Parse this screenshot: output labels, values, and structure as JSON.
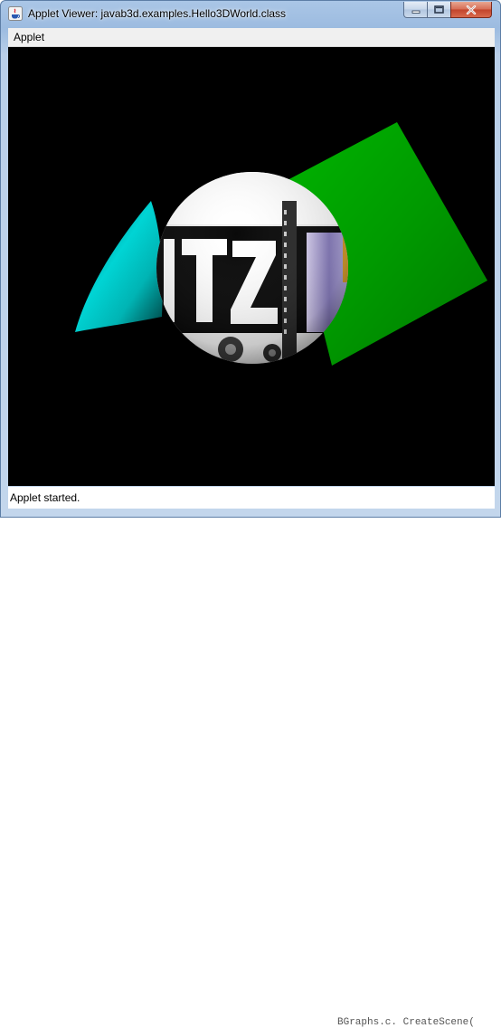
{
  "window": {
    "title": "Applet Viewer: javab3d.examples.Hello3DWorld.class",
    "icon": "java-cup-icon",
    "controls": {
      "minimize": "minimize-icon",
      "maximize": "maximize-icon",
      "close": "close-icon"
    }
  },
  "menubar": {
    "items": [
      {
        "label": "Applet"
      }
    ]
  },
  "scene": {
    "background": "#000000",
    "objects": [
      {
        "name": "cyan-cone",
        "color": "#00c8c8"
      },
      {
        "name": "green-cube",
        "color": "#00aa00"
      },
      {
        "name": "textured-sphere",
        "texture_text": "ITZ"
      }
    ]
  },
  "status": {
    "text": "Applet started."
  },
  "background_window": {
    "text": "BGraphs.c.  CreateScene("
  }
}
